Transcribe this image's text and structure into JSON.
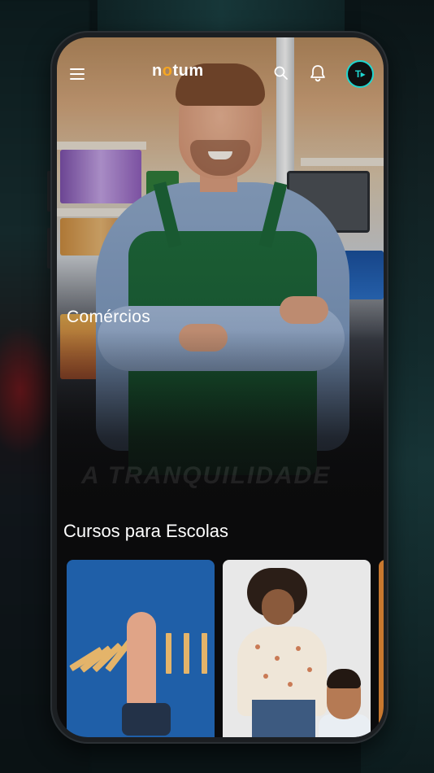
{
  "app": {
    "logo_text": "notum",
    "avatar_text": "T▸"
  },
  "hero": {
    "category_title": "Comércios",
    "watermark": "A TRANQUILIDADE"
  },
  "section": {
    "title": "Cursos para Escolas",
    "cards": [
      {
        "name": "course-card-1"
      },
      {
        "name": "course-card-2"
      },
      {
        "name": "course-card-3"
      }
    ]
  },
  "colors": {
    "accent": "#1fd6d0",
    "logo_dot": "#f5a623",
    "background": "#0b0b0c"
  },
  "icons": [
    "menu-icon",
    "search-icon",
    "bell-icon",
    "avatar"
  ]
}
